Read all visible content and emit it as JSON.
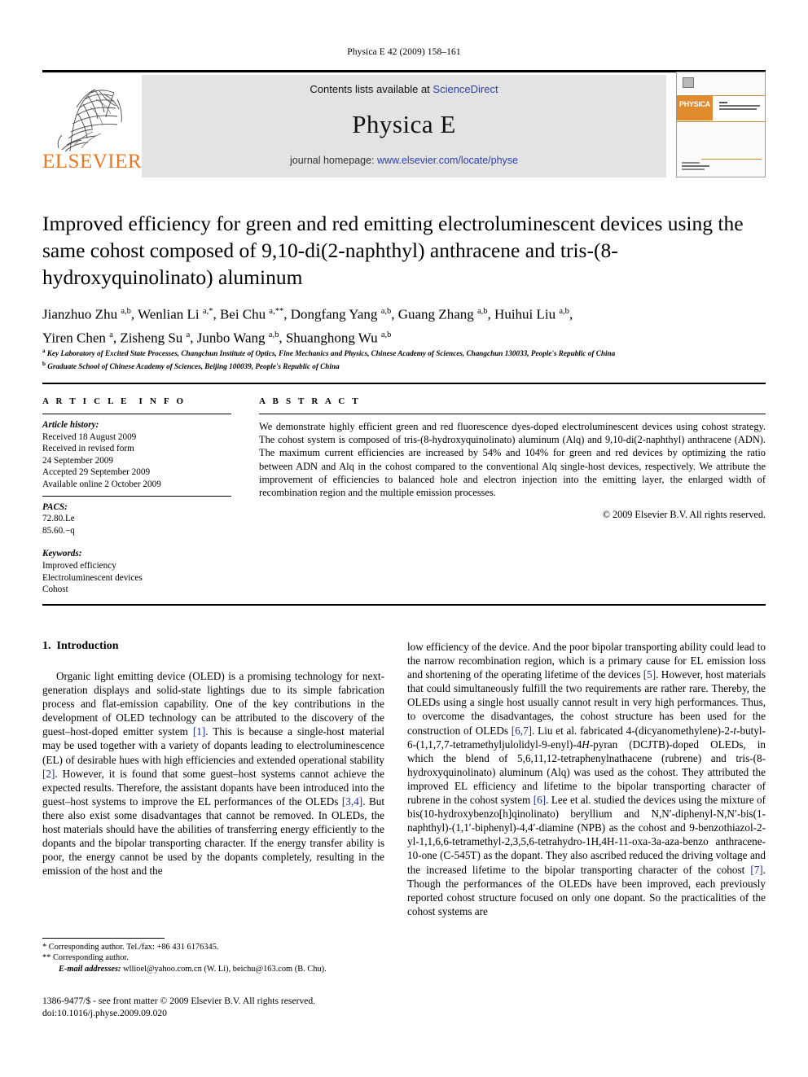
{
  "running_head": "Physica E 42 (2009) 158–161",
  "masthead": {
    "publisher_wordmark": "ELSEVIER",
    "contents_prefix": "Contents lists available at ",
    "contents_link": "ScienceDirect",
    "journal_title": "Physica E",
    "homepage_prefix": "journal homepage: ",
    "homepage_url": "www.elsevier.com/locate/physe",
    "cover_label": "PHYSICA",
    "link_color": "#2B3FAF",
    "brand_color": "#E87722",
    "banner_bg": "#e3e3e3"
  },
  "article": {
    "title": "Improved efficiency for green and red emitting electroluminescent devices using the same cohost composed of 9,10-di(2-naphthyl) anthracene and tris-(8-hydroxyquinolinato) aluminum",
    "authors": "Jianzhuo Zhu a,b, Wenlian Li a,*, Bei Chu a,**, Dongfang Yang a,b, Guang Zhang a,b, Huihui Liu a,b, Yiren Chen a, Zisheng Su a, Junbo Wang a,b, Shuanghong Wu a,b",
    "affiliations": [
      {
        "marker": "a",
        "text": "Key Laboratory of Excited State Processes, Changchun Institute of Optics, Fine Mechanics and Physics, Chinese Academy of Sciences, Changchun 130033, People's Republic of China"
      },
      {
        "marker": "b",
        "text": "Graduate School of Chinese Academy of Sciences, Beijing 100039, People's Republic of China"
      }
    ]
  },
  "info": {
    "heading": "A R T I C L E  I N F O",
    "history_label": "Article history:",
    "history": [
      "Received 18 August 2009",
      "Received in revised form",
      "24 September 2009",
      "Accepted 29 September 2009",
      "Available online 2 October 2009"
    ],
    "pacs_label": "PACS:",
    "pacs": [
      "72.80.Le",
      "85.60.−q"
    ],
    "keywords_label": "Keywords:",
    "keywords": [
      "Improved efficiency",
      "Electroluminescent devices",
      "Cohost"
    ]
  },
  "abstract": {
    "heading": "A B S T R A C T",
    "text": "We demonstrate highly efficient green and red fluorescence dyes-doped electroluminescent devices using cohost strategy. The cohost system is composed of tris-(8-hydroxyquinolinato) aluminum (Alq) and 9,10-di(2-naphthyl) anthracene (ADN). The maximum current efficiencies are increased by 54% and 104% for green and red devices by optimizing the ratio between ADN and Alq in the cohost compared to the conventional Alq single-host devices, respectively. We attribute the improvement of efficiencies to balanced hole and electron injection into the emitting layer, the enlarged width of recombination region and the multiple emission processes.",
    "copyright": "© 2009 Elsevier B.V. All rights reserved."
  },
  "introduction": {
    "number": "1.",
    "heading": "Introduction",
    "left_paragraph_1_a": "Organic light emitting device (OLED) is a promising technology for next-generation displays and solid-state lightings due to its simple fabrication process and flat-emission capability. One of the key contributions in the development of OLED technology can be attributed to the discovery of the guest–host-doped emitter system ",
    "cite_1": "[1]",
    "left_paragraph_1_b": ". This is because a single-host material may be used together with a variety of dopants leading to electroluminescence (EL) of desirable hues with high efficiencies and extended operational stability ",
    "cite_2": "[2]",
    "left_paragraph_1_c": ". However, it is found that some guest–host systems cannot achieve the expected results. Therefore, the assistant dopants have been introduced into the guest–host systems to improve the EL performances of the OLEDs ",
    "cite_34": "[3,4]",
    "left_paragraph_1_d": ". But there also exist some disadvantages that cannot be removed. In OLEDs, the host materials should have the abilities of transferring energy efficiently to the dopants and the bipolar transporting character. If the energy transfer ability is poor, the energy cannot be used by the dopants completely, resulting in the emission of the host and the",
    "right_a": "low efficiency of the device. And the poor bipolar transporting ability could lead to the narrow recombination region, which is a primary cause for EL emission loss and shortening of the operating lifetime of the devices ",
    "cite_5": "[5]",
    "right_b": ". However, host materials that could simultaneously fulfill the two requirements are rather rare. Thereby, the OLEDs using a single host usually cannot result in very high performances. Thus, to overcome the disadvantages, the cohost structure has been used for the construction of OLEDs ",
    "cite_67": "[6,7]",
    "right_c": ". Liu et al. fabricated 4-(dicyanomethylene)-2-",
    "ital_t": "t",
    "right_d": "-butyl-6-(1,1,7,7-tetramethyljulolidyl-9-enyl)-4",
    "ital_H": "H",
    "right_e": "-pyran (DCJTB)-doped OLEDs, in which the blend of 5,6,11,12-tetraphenylnathacene (rubrene) and tris-(8-hydroxyquinolinato) aluminum (Alq) was used as the cohost. They attributed the improved EL efficiency and lifetime to the bipolar transporting character of rubrene in the cohost system ",
    "cite_6": "[6]",
    "right_f": ". Lee et al. studied the devices using the mixture of bis(10-hydroxybenzo[h]qinolinato) beryllium and N,N′-diphenyl-N,N′-bis(1-naphthyl)-(1,1′-biphenyl)-4,4′-diamine (NPB) as the cohost and 9-benzothiazol-2-yl-1,1,6,6-tetramethyl-2,3,5,6-tetrahydro-1H,4H-11-oxa-3a-aza-benzo anthracene-10-one (C-545T) as the dopant. They also ascribed reduced the driving voltage and the increased lifetime to the bipolar transporting character of the cohost ",
    "cite_7": "[7]",
    "right_g": ". Though the performances of the OLEDs have been improved, each previously reported cohost structure focused on only one dopant. So the practicalities of the cohost systems are"
  },
  "footnotes": {
    "star": "* Corresponding author. Tel./fax: +86 431 6176345.",
    "doublestar": "** Corresponding author.",
    "email_label": "E-mail addresses:",
    "emails": "wllioel@yahoo.com.cn (W. Li), beichu@163.com (B. Chu)."
  },
  "imprint": {
    "line1": "1386-9477/$ - see front matter © 2009 Elsevier B.V. All rights reserved.",
    "line2": "doi:10.1016/j.physe.2009.09.020"
  }
}
